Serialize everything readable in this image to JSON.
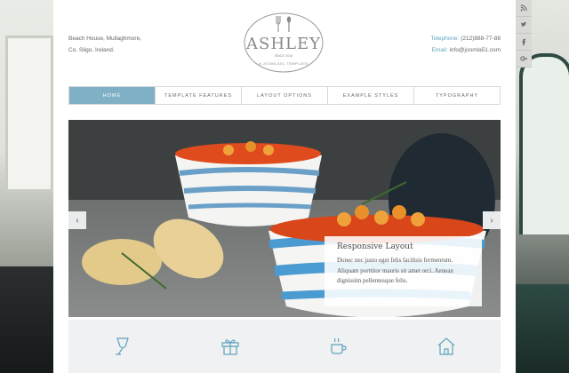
{
  "header": {
    "address_line1": "Beach House, Mullaghmore,",
    "address_line2": "Co. Sligo, Ireland.",
    "telephone_label": "Telephone:",
    "telephone_value": "(212)888-77-88",
    "email_label": "Email:",
    "email_value": "info@joomla51.com"
  },
  "logo": {
    "name": "ASHLEY",
    "since": "SINCE 2014",
    "tagline": "A JOOMLA51 TEMPLATE"
  },
  "nav": {
    "items": [
      {
        "label": "Home"
      },
      {
        "label": "Template Features"
      },
      {
        "label": "Layout Options"
      },
      {
        "label": "Example Styles"
      },
      {
        "label": "Typography"
      }
    ]
  },
  "slider": {
    "caption_title": "Responsive Layout",
    "caption_text": "Donec nec justo eget felis facilisis fermentum. Aliquam porttitor mauris sit amet orci. Aenean dignissim pellentesque felis."
  },
  "features": {
    "icons": [
      "wine-glass-icon",
      "gift-icon",
      "coffee-cup-icon",
      "house-icon"
    ]
  },
  "social": {
    "icons": [
      "rss-icon",
      "twitter-icon",
      "facebook-icon",
      "google-plus-icon"
    ]
  },
  "colors": {
    "accent": "#7fb0c5",
    "link": "#5fa4bc",
    "logo": "#8a8a8a"
  }
}
